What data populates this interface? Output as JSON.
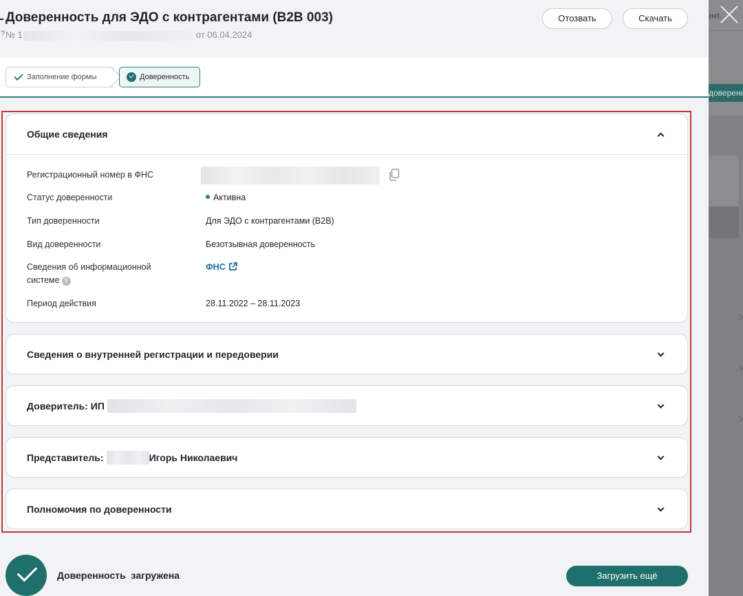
{
  "background_page": {
    "top_text": "ент.",
    "chip_label": "доверенн"
  },
  "header": {
    "title": "Доверенность для ЭДО с контрагентами (B2B 003)",
    "number_prefix": "№ 1",
    "date_text": "от 06.04.2024",
    "revoke_label": "Отозвать",
    "download_label": "Скачать"
  },
  "steps": [
    {
      "label": "Заполнение формы"
    },
    {
      "label": "Доверенность"
    }
  ],
  "general": {
    "title": "Общие сведения",
    "rows": {
      "reg_number_label": "Регистрационный номер в ФНС",
      "status_label": "Статус доверенности",
      "status_value": "Активна",
      "type_label": "Тип доверенности",
      "type_value": "Для ЭДО с контрагентами (B2B)",
      "kind_label": "Вид доверенности",
      "kind_value": "Безотзывная доверенность",
      "info_system_label_line1": "Сведения об информационной",
      "info_system_label_line2": "системе",
      "info_system_value": "ФНС",
      "period_label": "Период действия",
      "period_value": "28.11.2022 – 28.11.2023"
    }
  },
  "sections": {
    "internal_registration": "Сведения о внутренней регистрации и передоверии",
    "principal_prefix": "Доверитель: ИП",
    "representative_prefix": "Представитель:",
    "representative_name": "Игорь Николаевич",
    "powers": "Полномочия по доверенности"
  },
  "footer": {
    "status_text": "Доверенность  загружена",
    "upload_more_label": "Загрузить ещё"
  },
  "colors": {
    "accent": "#1f6f6c",
    "highlight_frame": "#c2353a",
    "link": "#1f6f9c"
  }
}
